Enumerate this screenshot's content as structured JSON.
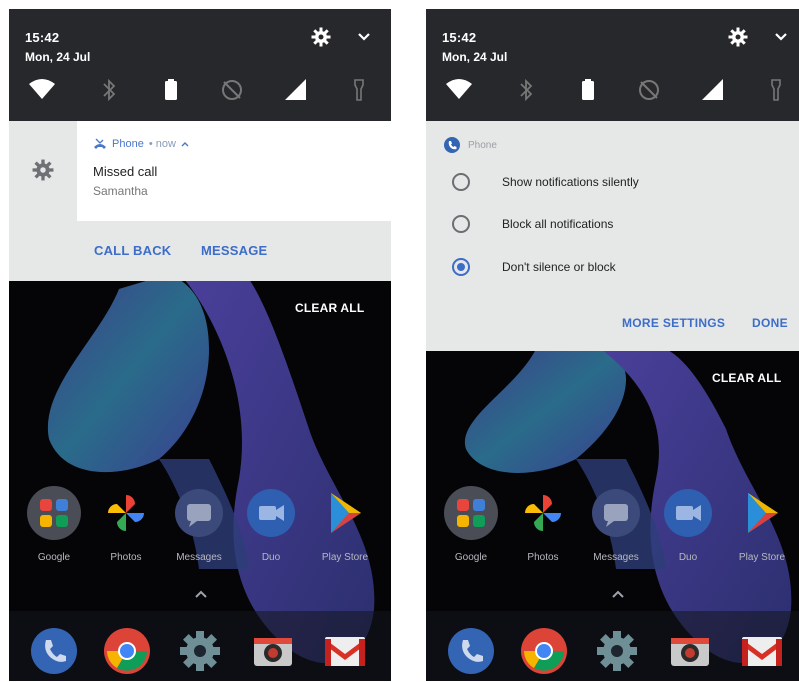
{
  "screens": [
    {
      "status": {
        "time": "15:42",
        "date": "Mon, 24 Jul"
      },
      "notification": {
        "app": "Phone",
        "meta": "• now",
        "title": "Missed call",
        "text": "Samantha",
        "actions": [
          "CALL BACK",
          "MESSAGE"
        ]
      },
      "clear_all": "CLEAR ALL",
      "apps": [
        "Google",
        "Photos",
        "Messages",
        "Duo",
        "Play Store"
      ]
    },
    {
      "status": {
        "time": "15:42",
        "date": "Mon, 24 Jul"
      },
      "settings": {
        "app": "Phone",
        "options": [
          "Show notifications silently",
          "Block all notifications",
          "Don't silence or block"
        ],
        "selected_index": 2,
        "more_settings": "MORE SETTINGS",
        "done": "DONE"
      },
      "clear_all": "CLEAR ALL",
      "apps": [
        "Google",
        "Photos",
        "Messages",
        "Duo",
        "Play Store"
      ]
    }
  ],
  "colors": {
    "accent": "#3d6dc8",
    "statusbar": "#26282b",
    "panel": "#e6e7e7"
  },
  "icons": {
    "quick_settings": [
      "wifi-icon",
      "bluetooth-icon",
      "battery-icon",
      "dnd-icon",
      "signal-icon",
      "flashlight-icon"
    ],
    "dock": [
      "phone-icon",
      "chrome-icon",
      "settings-icon",
      "camera-icon",
      "gmail-icon"
    ]
  }
}
